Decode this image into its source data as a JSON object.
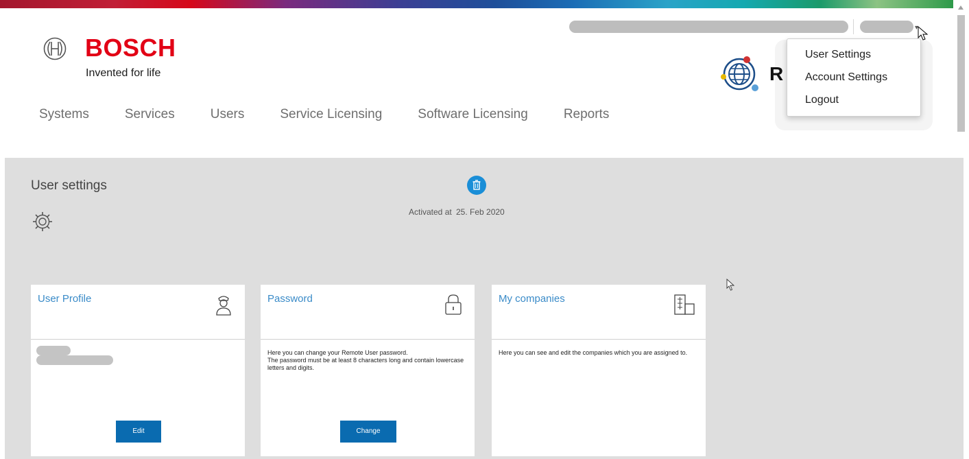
{
  "header": {
    "brand": "BOSCH",
    "tagline": "Invented for life",
    "app_name_partial": "R",
    "colors": {
      "brand_red": "#e20015",
      "accent_blue": "#1a8ed7",
      "button_blue": "#0a6bb0"
    }
  },
  "nav": {
    "items": [
      "Systems",
      "Services",
      "Users",
      "Service Licensing",
      "Software Licensing",
      "Reports"
    ]
  },
  "user_menu": {
    "items": [
      "User Settings",
      "Account Settings",
      "Logout"
    ]
  },
  "page": {
    "title": "User settings",
    "activated_label": "Activated at",
    "activated_value": "25. Feb 2020"
  },
  "cards": [
    {
      "title": "User Profile",
      "icon": "user-icon",
      "text": "",
      "button": "Edit"
    },
    {
      "title": "Password",
      "icon": "lock-icon",
      "text_line1": "Here you can change your Remote User password.",
      "text_line2": "The password must be at least 8 characters long and contain lowercase letters and digits.",
      "button": "Change"
    },
    {
      "title": "My companies",
      "icon": "building-icon",
      "text": "Here you can see and edit the companies which you are assigned to."
    }
  ]
}
